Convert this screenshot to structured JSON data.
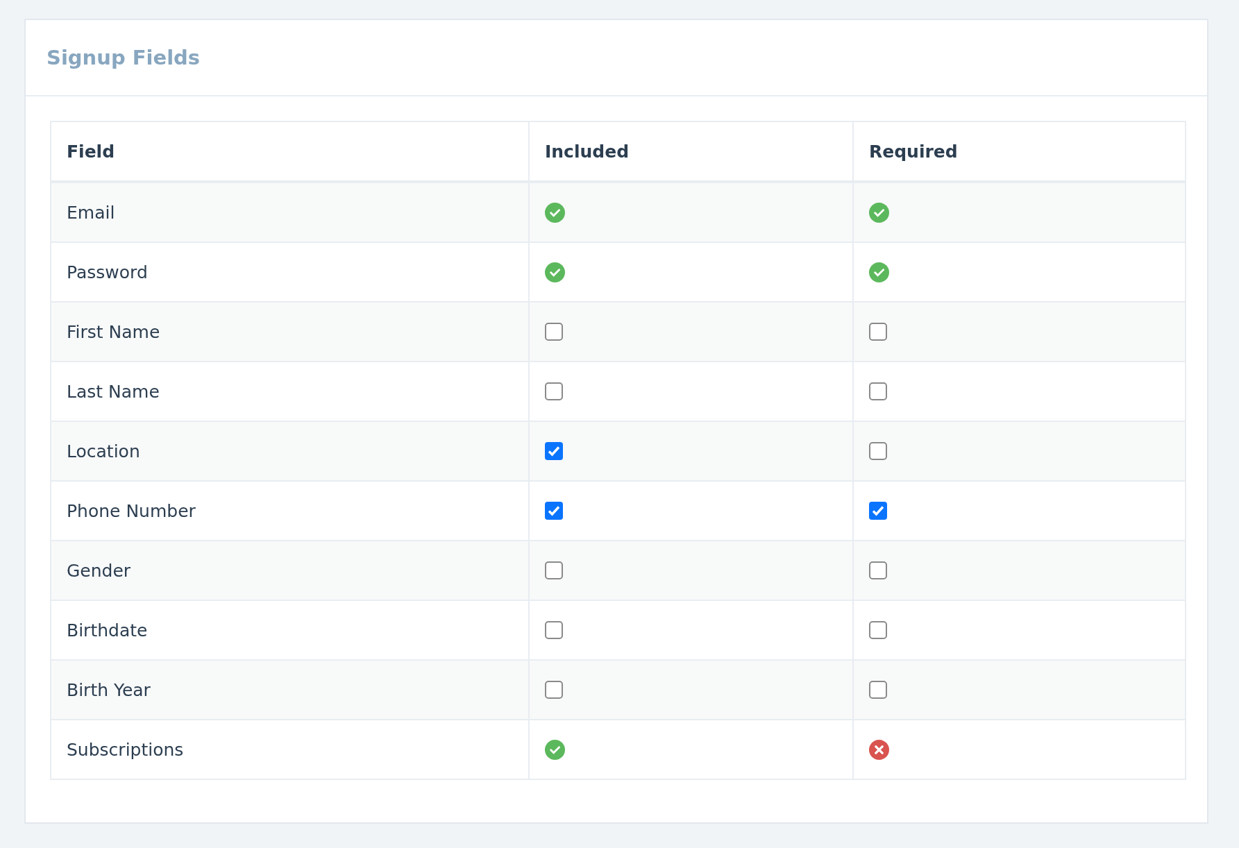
{
  "panel": {
    "title": "Signup Fields"
  },
  "table": {
    "columns": [
      "Field",
      "Included",
      "Required"
    ],
    "rows": [
      {
        "field": "Email",
        "included": {
          "kind": "status",
          "on": true
        },
        "required": {
          "kind": "status",
          "on": true
        }
      },
      {
        "field": "Password",
        "included": {
          "kind": "status",
          "on": true
        },
        "required": {
          "kind": "status",
          "on": true
        }
      },
      {
        "field": "First Name",
        "included": {
          "kind": "checkbox",
          "checked": false
        },
        "required": {
          "kind": "checkbox",
          "checked": false
        }
      },
      {
        "field": "Last Name",
        "included": {
          "kind": "checkbox",
          "checked": false
        },
        "required": {
          "kind": "checkbox",
          "checked": false
        }
      },
      {
        "field": "Location",
        "included": {
          "kind": "checkbox",
          "checked": true
        },
        "required": {
          "kind": "checkbox",
          "checked": false
        }
      },
      {
        "field": "Phone Number",
        "included": {
          "kind": "checkbox",
          "checked": true
        },
        "required": {
          "kind": "checkbox",
          "checked": true
        }
      },
      {
        "field": "Gender",
        "included": {
          "kind": "checkbox",
          "checked": false
        },
        "required": {
          "kind": "checkbox",
          "checked": false
        }
      },
      {
        "field": "Birthdate",
        "included": {
          "kind": "checkbox",
          "checked": false
        },
        "required": {
          "kind": "checkbox",
          "checked": false
        }
      },
      {
        "field": "Birth Year",
        "included": {
          "kind": "checkbox",
          "checked": false
        },
        "required": {
          "kind": "checkbox",
          "checked": false
        }
      },
      {
        "field": "Subscriptions",
        "included": {
          "kind": "status",
          "on": true
        },
        "required": {
          "kind": "status",
          "on": false
        }
      }
    ]
  }
}
